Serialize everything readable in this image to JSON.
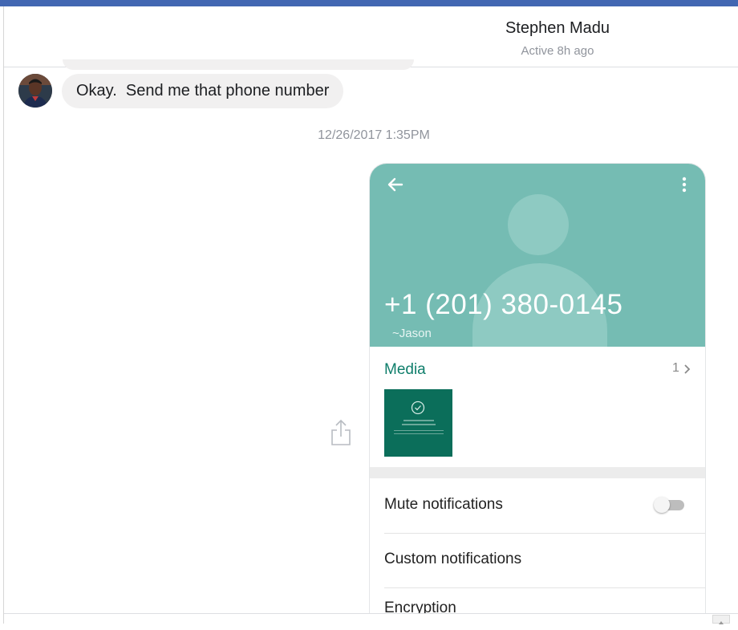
{
  "header": {
    "contact_name": "Stephen Madu",
    "active_status": "Active 8h ago"
  },
  "messages": {
    "incoming_text": "Okay.  Send me that phone number",
    "timestamp": "12/26/2017 1:35PM"
  },
  "contact_card": {
    "phone_number": "+1 (201) 380-0145",
    "push_name": "~Jason",
    "media_label": "Media",
    "media_count": "1",
    "rows": [
      {
        "label": "Mute notifications"
      },
      {
        "label": "Custom notifications"
      },
      {
        "label": "Encryption"
      }
    ],
    "mute_enabled": false
  },
  "colors": {
    "header_accent": "#4267b2",
    "card_header": "#75bcb3",
    "media_label": "#0f7e6b",
    "thumb": "#0b6e5a",
    "bubble": "#f1f0f0"
  },
  "icons": [
    "back-arrow-icon",
    "more-vert-icon",
    "chevron-right-icon",
    "check-circle-icon",
    "share-icon",
    "avatar-photo"
  ]
}
